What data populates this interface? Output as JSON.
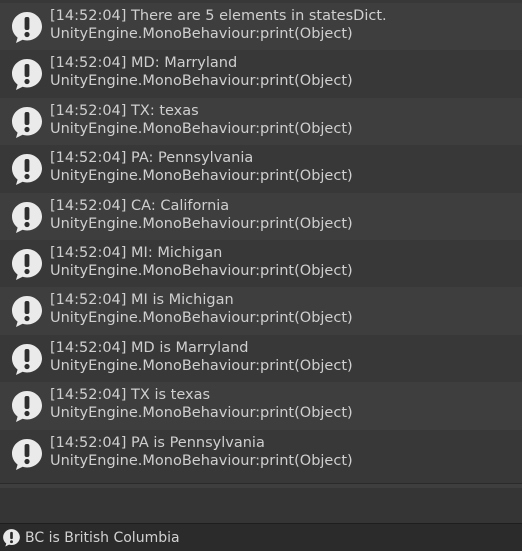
{
  "logs": [
    {
      "message": "[14:52:04] There are 5 elements in statesDict.",
      "source": "UnityEngine.MonoBehaviour:print(Object)",
      "icon": "info-bubble-icon"
    },
    {
      "message": "[14:52:04] MD: Marryland",
      "source": "UnityEngine.MonoBehaviour:print(Object)",
      "icon": "info-bubble-icon"
    },
    {
      "message": "[14:52:04] TX: texas",
      "source": "UnityEngine.MonoBehaviour:print(Object)",
      "icon": "info-bubble-icon"
    },
    {
      "message": "[14:52:04] PA: Pennsylvania",
      "source": "UnityEngine.MonoBehaviour:print(Object)",
      "icon": "info-bubble-icon"
    },
    {
      "message": "[14:52:04] CA: California",
      "source": "UnityEngine.MonoBehaviour:print(Object)",
      "icon": "info-bubble-icon"
    },
    {
      "message": "[14:52:04] MI: Michigan",
      "source": "UnityEngine.MonoBehaviour:print(Object)",
      "icon": "info-bubble-icon"
    },
    {
      "message": "[14:52:04] MI is Michigan",
      "source": "UnityEngine.MonoBehaviour:print(Object)",
      "icon": "info-bubble-icon"
    },
    {
      "message": "[14:52:04] MD is Marryland",
      "source": "UnityEngine.MonoBehaviour:print(Object)",
      "icon": "info-bubble-icon"
    },
    {
      "message": "[14:52:04] TX is texas",
      "source": "UnityEngine.MonoBehaviour:print(Object)",
      "icon": "info-bubble-icon"
    },
    {
      "message": "[14:52:04] PA is Pennsylvania",
      "source": "UnityEngine.MonoBehaviour:print(Object)",
      "icon": "info-bubble-icon"
    }
  ],
  "status_bar": {
    "message": "BC is British Columbia",
    "icon": "info-bubble-icon"
  },
  "colors": {
    "row_even": "#3e3e3e",
    "row_odd": "#383838",
    "text": "#cfcfcf",
    "icon_fill": "#eaeaea",
    "icon_glyph": "#2e2e2e"
  }
}
